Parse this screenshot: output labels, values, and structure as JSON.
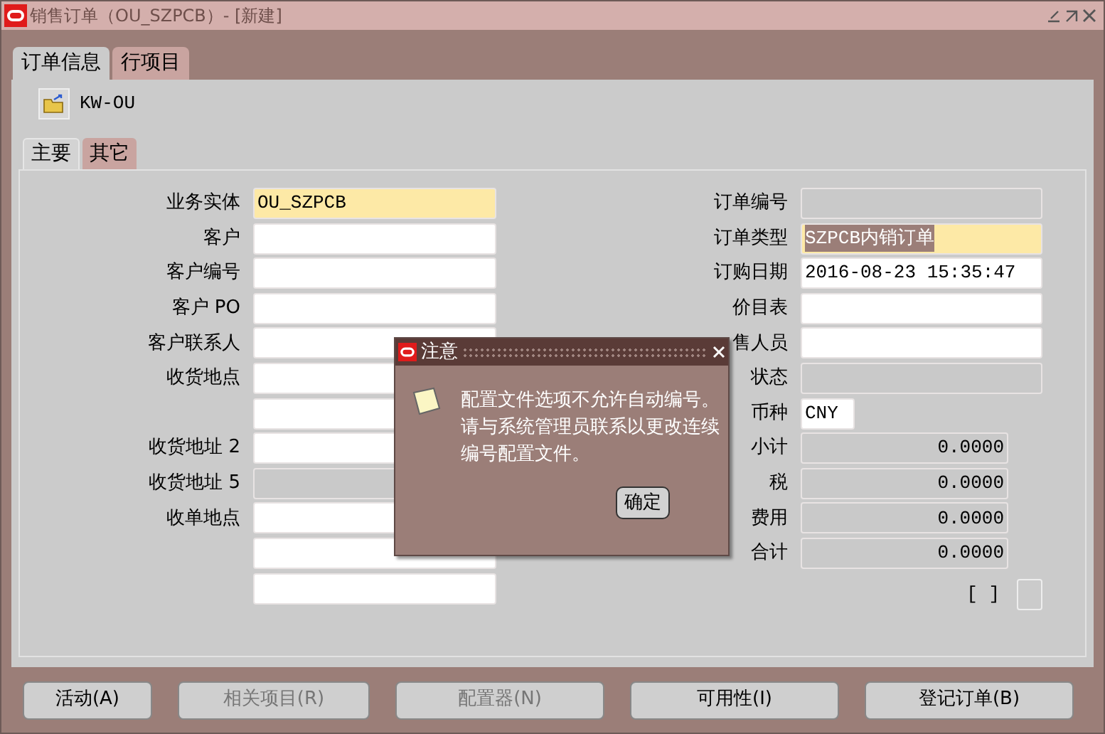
{
  "window": {
    "title": "销售订单（OU_SZPCB）- [新建]"
  },
  "tabs": [
    {
      "label": "订单信息",
      "selected": true
    },
    {
      "label": "行项目",
      "selected": false
    }
  ],
  "org_button": {
    "label": "KW-OU"
  },
  "subtabs": [
    {
      "label": "主要",
      "selected": true
    },
    {
      "label": "其它",
      "selected": false
    }
  ],
  "left_fields": [
    {
      "label": "业务实体",
      "value": "OU_SZPCB",
      "kind": "required"
    },
    {
      "label": "客户",
      "kind": "normal"
    },
    {
      "label": "客户编号",
      "kind": "normal"
    },
    {
      "label": "客户 PO",
      "kind": "normal"
    },
    {
      "label": "客户联系人",
      "kind": "normal"
    },
    {
      "label": "收货地点",
      "kind": "normal"
    },
    {
      "kind": "normal"
    },
    {
      "label": "收货地址 2",
      "kind": "normal"
    },
    {
      "label": "收货地址 5",
      "kind": "readonly"
    },
    {
      "label": "收单地点",
      "kind": "normal"
    },
    {
      "kind": "normal"
    },
    {
      "kind": "normal"
    }
  ],
  "right_fields": [
    {
      "label": "订单编号",
      "kind": "readonly"
    },
    {
      "label": "订单类型",
      "value": "SZPCB内销订单",
      "kind": "required",
      "highlighted": true
    },
    {
      "label": "订购日期",
      "value": "2016-08-23 15:35:47",
      "kind": "normal"
    },
    {
      "label": "价目表",
      "kind": "normal"
    },
    {
      "label": "售人员",
      "kind": "normal"
    },
    {
      "label": "状态",
      "kind": "readonly"
    },
    {
      "label": "币种",
      "value": "CNY",
      "kind": "short"
    },
    {
      "label": "小计",
      "value": "0.0000",
      "kind": "amount"
    },
    {
      "label": "税",
      "value": "0.0000",
      "kind": "amount"
    },
    {
      "label": "费用",
      "value": "0.0000",
      "kind": "amount"
    },
    {
      "label": "合计",
      "value": "0.0000",
      "kind": "amount"
    }
  ],
  "bracket_text": "[ ]",
  "flag_box": {
    "checked": false
  },
  "dialog": {
    "title": "注意",
    "message": "配置文件选项不允许自动编号。请与系统管理员联系以更改连续编号配置文件。",
    "button": "确定"
  },
  "buttons": [
    {
      "label": "活动(A)",
      "disabled": false
    },
    {
      "label": "相关项目(R)",
      "disabled": true
    },
    {
      "label": "配置器(N)",
      "disabled": true
    },
    {
      "label": "可用性(I)",
      "disabled": false
    },
    {
      "label": "登记订单(B)",
      "disabled": false
    }
  ]
}
